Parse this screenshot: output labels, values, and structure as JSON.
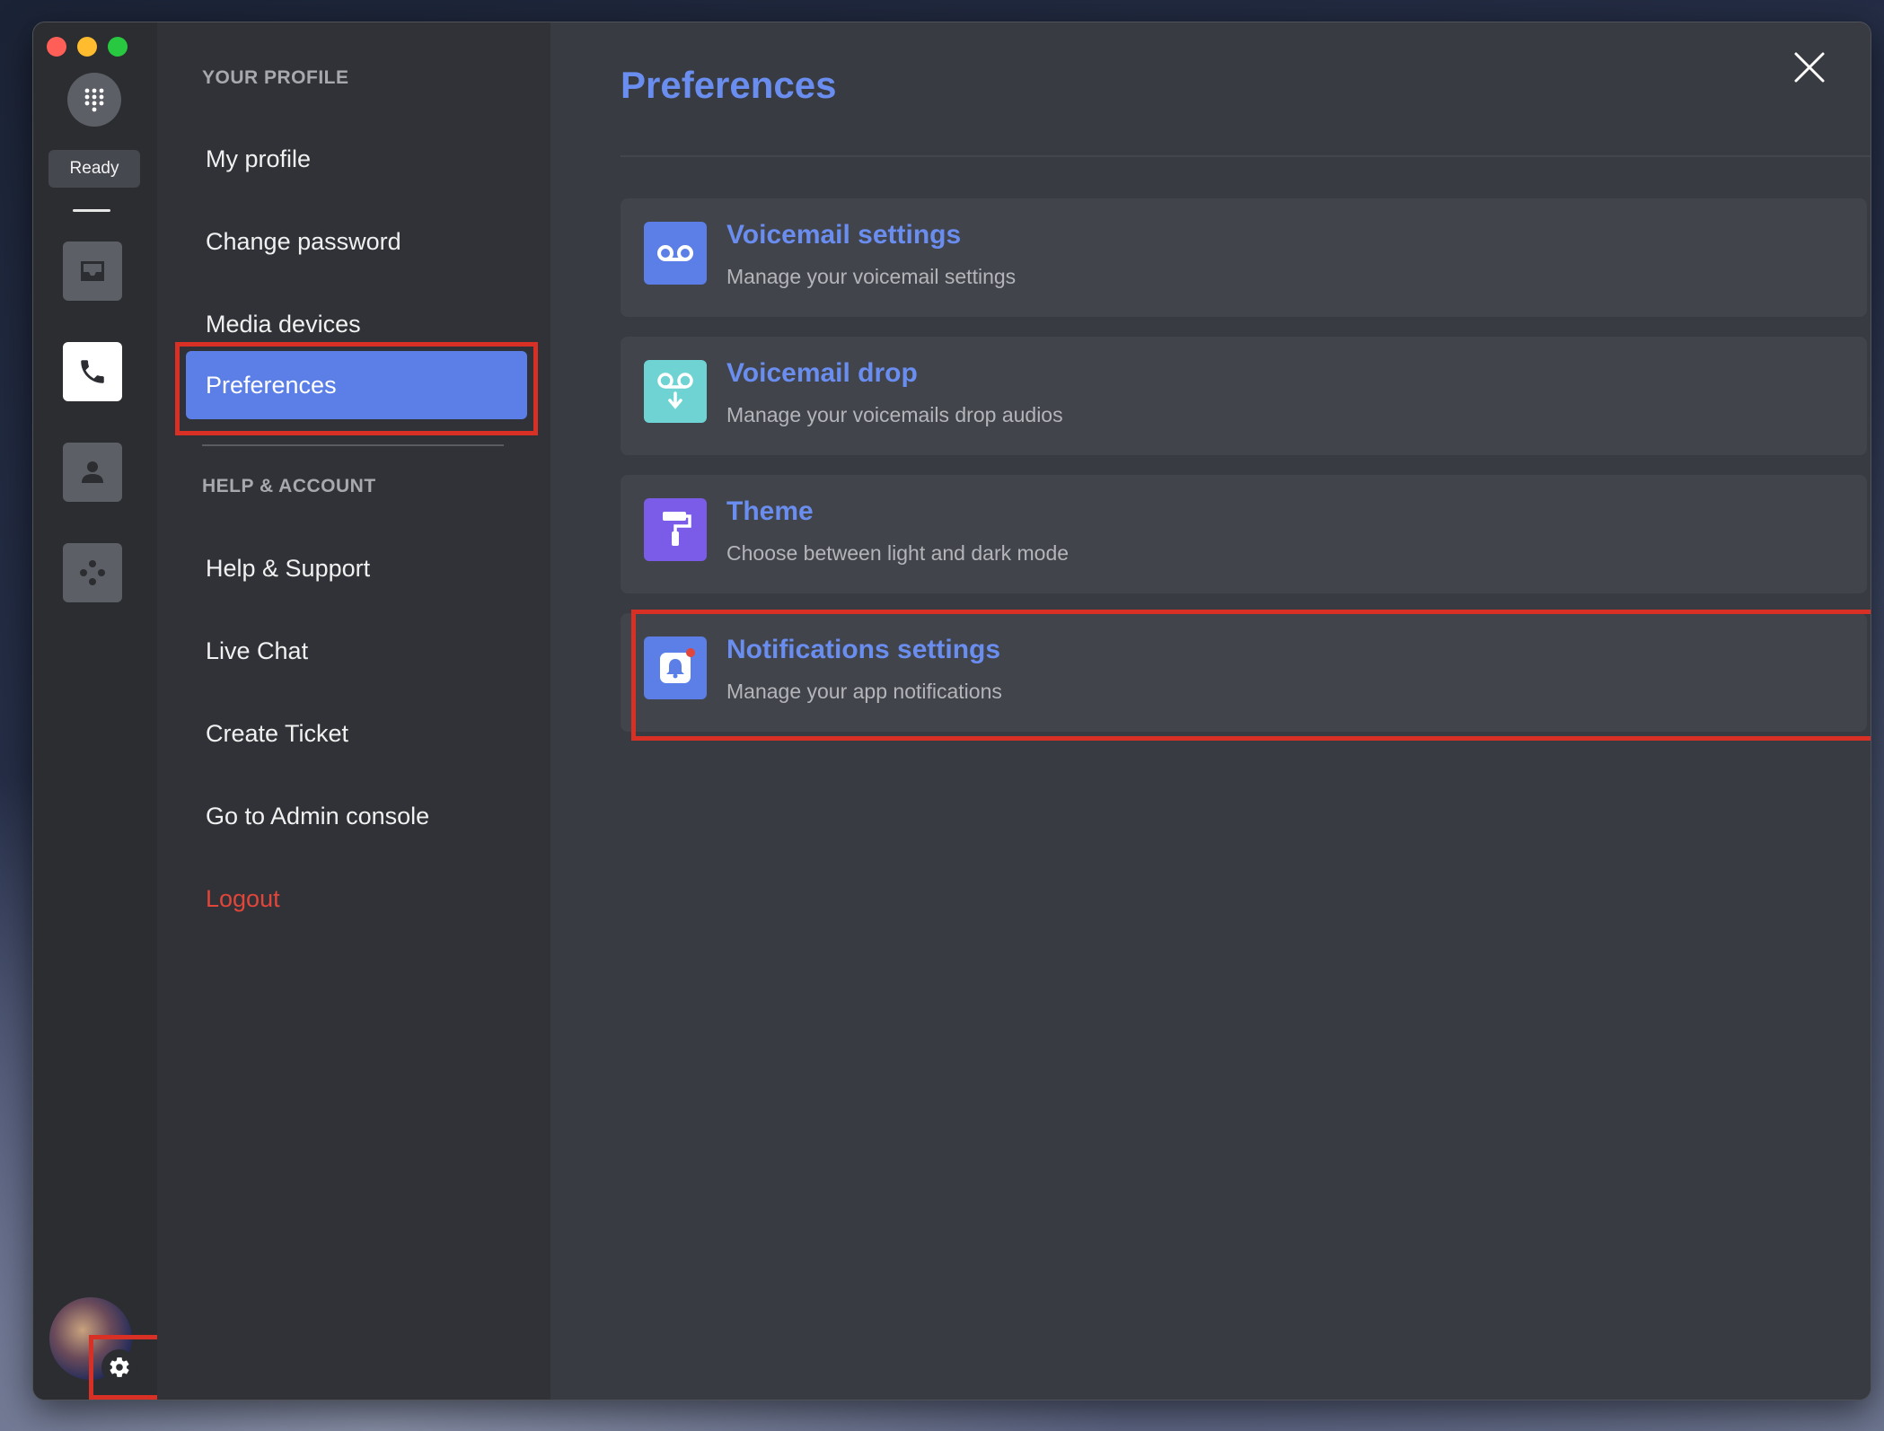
{
  "rail": {
    "status": "Ready"
  },
  "menu": {
    "section_profile": "YOUR PROFILE",
    "items_profile": [
      {
        "label": "My profile"
      },
      {
        "label": "Change password"
      },
      {
        "label": "Media devices"
      },
      {
        "label": "Preferences"
      }
    ],
    "section_help": "HELP & ACCOUNT",
    "items_help": [
      {
        "label": "Help & Support"
      },
      {
        "label": "Live Chat"
      },
      {
        "label": "Create Ticket"
      },
      {
        "label": "Go to Admin console"
      },
      {
        "label": "Logout"
      }
    ]
  },
  "main": {
    "title": "Preferences",
    "cards": [
      {
        "title": "Voicemail settings",
        "subtitle": "Manage your voicemail settings",
        "icon": "voicemail-icon",
        "color": "#5b7fe6"
      },
      {
        "title": "Voicemail drop",
        "subtitle": "Manage your voicemails drop audios",
        "icon": "voicemail-drop-icon",
        "color": "#6fd3d3"
      },
      {
        "title": "Theme",
        "subtitle": "Choose between light and dark mode",
        "icon": "paint-roller-icon",
        "color": "#7b5ce8"
      },
      {
        "title": "Notifications settings",
        "subtitle": "Manage your app notifications",
        "icon": "bell-icon",
        "color": "#5b7fe6"
      }
    ]
  },
  "colors": {
    "accent": "#6a8df0",
    "active_item": "#5b7fe6",
    "danger": "#e2453a",
    "highlight_box": "#d93025"
  }
}
